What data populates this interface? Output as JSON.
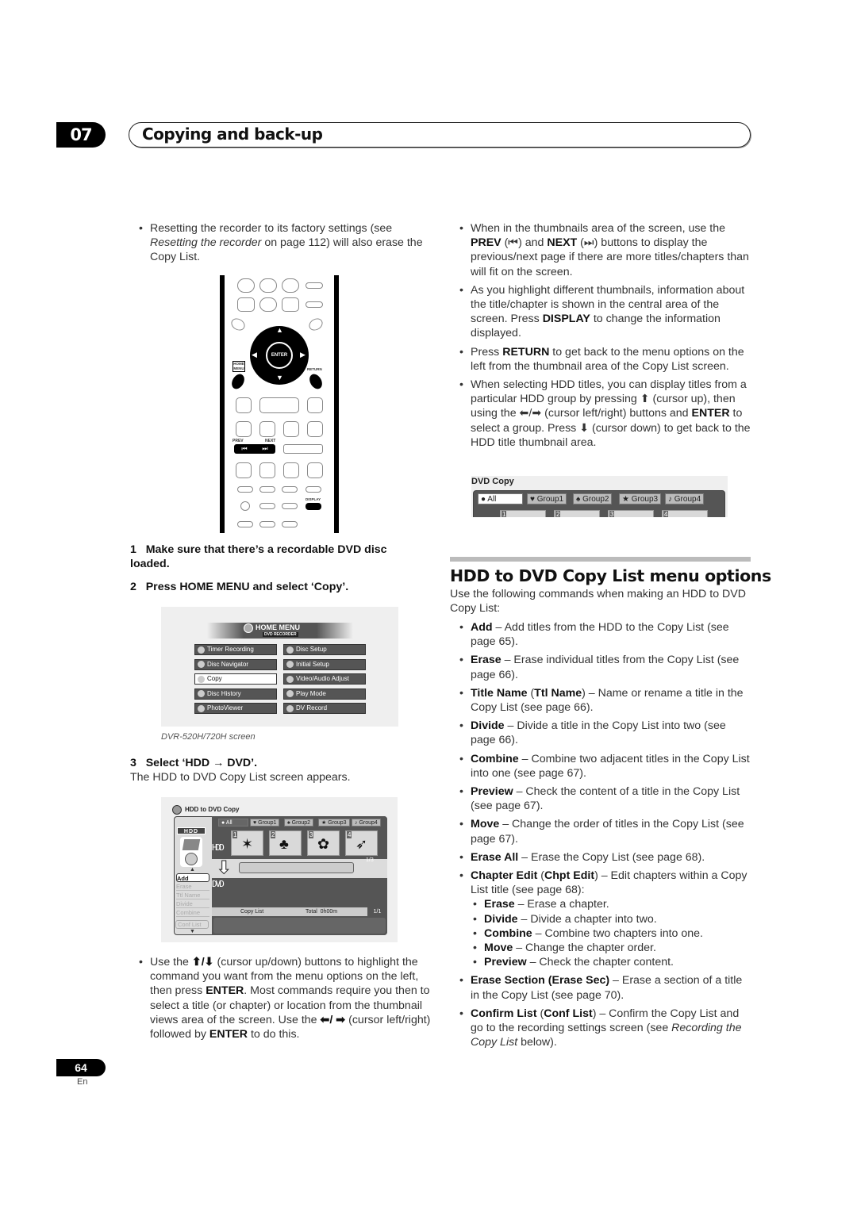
{
  "header": {
    "chapter_number": "07",
    "chapter_title": "Copying and back-up"
  },
  "left_column": {
    "reset_bullet": {
      "pre": "Resetting the recorder to its factory settings (see ",
      "italic": "Resetting the recorder",
      "post": " on page 112) will also erase the Copy List."
    },
    "remote": {
      "labels": {
        "enter": "ENTER",
        "home_menu": "HOME MENU",
        "return": "RETURN",
        "prev": "PREV",
        "next": "NEXT",
        "display": "DISPLAY",
        "prev_glyph": "⏮",
        "next_glyph": "⏭"
      }
    },
    "step1": {
      "num": "1",
      "text": "Make sure that there’s a recordable DVD disc loaded."
    },
    "step2": {
      "num": "2",
      "text": "Press HOME MENU and select ‘Copy’."
    },
    "home_menu_screen": {
      "title": "HOME MENU",
      "subtitle": "DVD RECORDER",
      "left_items": [
        {
          "label": "Timer Recording",
          "selected": false
        },
        {
          "label": "Disc Navigator",
          "selected": false
        },
        {
          "label": "Copy",
          "selected": true
        },
        {
          "label": "Disc History",
          "selected": false
        },
        {
          "label": "PhotoViewer",
          "selected": false
        }
      ],
      "right_items": [
        {
          "label": "Disc Setup"
        },
        {
          "label": "Initial Setup"
        },
        {
          "label": "Video/Audio Adjust"
        },
        {
          "label": "Play Mode"
        },
        {
          "label": "DV Record"
        }
      ],
      "caption": "DVR-520H/720H screen"
    },
    "step3": {
      "num": "3",
      "text": "Select ‘HDD → DVD’.",
      "desc": "The HDD to DVD Copy List screen appears."
    },
    "copy_screen": {
      "title": "HDD to DVD Copy",
      "group_tabs": [
        "All",
        "Group1",
        "Group2",
        "Group3",
        "Group4"
      ],
      "group_icons": [
        "●",
        "♥",
        "♠",
        "★",
        "♪"
      ],
      "hdd_badge": "HDD",
      "hdd_label": "HDD",
      "dvd_label": "DVD",
      "thumbs": [
        "1",
        "2",
        "3",
        "4"
      ],
      "hdd_page": "1/3",
      "commands": [
        {
          "label": "Add",
          "active": true
        },
        {
          "label": "Erase",
          "active": false
        },
        {
          "label": "Ttl Name",
          "active": false
        },
        {
          "label": "Divide",
          "active": false
        },
        {
          "label": "Combine",
          "active": false
        }
      ],
      "conf_list": "Conf List",
      "copy_list_label": "Copy List",
      "total": "Total  0h00m",
      "dvd_page": "1/1"
    },
    "cursor_bullet": {
      "t1": "Use the ",
      "arrows_ud": "⬆/⬇",
      "t2": " (cursor up/down) buttons to highlight the command you want from the menu options on the left, then press ",
      "b1": "ENTER",
      "t3": ". Most commands require you then to select a title (or chapter) or location from the thumbnail views area of the screen. Use the ",
      "arrows_lr": "⬅/ ➡",
      "t4": " (cursor left/right) followed by ",
      "b2": "ENTER",
      "t5": " to do this."
    }
  },
  "right_column": {
    "bullets_top": [
      {
        "html_parts": [
          "When in the thumbnails area of the screen, use the ",
          "**PREV",
          " (⏮) and ",
          "**NEXT",
          " (⏭) buttons to display the previous/next page if there are more titles/chapters than will fit on the screen."
        ]
      },
      {
        "html_parts": [
          "As you highlight different thumbnails, information about the title/chapter is shown in the central area of the screen. Press ",
          "**DISPLAY",
          " to change the information displayed."
        ]
      },
      {
        "html_parts": [
          "Press ",
          "**RETURN",
          " to get back to the menu options on the left from the thumbnail area of the Copy List screen."
        ]
      },
      {
        "html_parts": [
          "When selecting HDD titles, you can display titles from a particular HDD group by pressing ⬆ (cursor up), then using the ⬅/➡ (cursor left/right) buttons and ",
          "**ENTER",
          " to select a group. Press ⬇ (cursor down) to get back to the HDD title thumbnail area."
        ]
      }
    ],
    "dvd_copy_crop": {
      "title": "DVD Copy",
      "tabs": [
        "All",
        "Group1",
        "Group2",
        "Group3",
        "Group4"
      ],
      "icons": [
        "●",
        "♥",
        "♠",
        "★",
        "♪"
      ],
      "thumbs": [
        "1",
        "2",
        "3",
        "4"
      ]
    },
    "section_title": "HDD to DVD Copy List menu options",
    "intro": "Use the following commands when making an HDD to DVD Copy List:",
    "options": [
      {
        "html_parts": [
          "**Add",
          " – Add titles from the HDD to the Copy List (see page 65)."
        ]
      },
      {
        "html_parts": [
          "**Erase",
          " – Erase individual titles from the Copy List (see page 66)."
        ]
      },
      {
        "html_parts": [
          "**Title Name",
          " (",
          "**Ttl Name",
          ") – Name or rename a title in the Copy List (see page 66)."
        ]
      },
      {
        "html_parts": [
          "**Divide",
          " – Divide a title in the Copy List into two (see page 66)."
        ]
      },
      {
        "html_parts": [
          "**Combine",
          " – Combine two adjacent titles in the Copy List into one (see page 67)."
        ]
      },
      {
        "html_parts": [
          "**Preview",
          " – Check the content of a title in the Copy List (see page 67)."
        ]
      },
      {
        "html_parts": [
          "**Move",
          " – Change the order of titles in the Copy List (see page 67)."
        ]
      },
      {
        "html_parts": [
          "**Erase All",
          " – Erase the Copy List (see page 68)."
        ]
      },
      {
        "html_parts": [
          "**Chapter Edit",
          " (",
          "**Chpt Edit",
          ") – Edit chapters within a Copy List title (see page 68):"
        ]
      }
    ],
    "chapter_sub": [
      {
        "html_parts": [
          "**Erase",
          " – Erase a chapter."
        ]
      },
      {
        "html_parts": [
          "**Divide",
          " – Divide a chapter into two."
        ]
      },
      {
        "html_parts": [
          "**Combine",
          " – Combine two chapters into one."
        ]
      },
      {
        "html_parts": [
          "**Move",
          " – Change the chapter order."
        ]
      },
      {
        "html_parts": [
          "**Preview",
          " – Check the chapter content."
        ]
      }
    ],
    "options_after": [
      {
        "html_parts": [
          "**Erase Section (Erase Sec)",
          " – Erase a section of a title in the Copy List (see page 70)."
        ]
      },
      {
        "html_parts": [
          "**Confirm List",
          " (",
          "**Conf List",
          ") – Confirm the Copy List and go to the recording settings screen (see ",
          "//Recording the Copy List",
          " below)."
        ]
      }
    ]
  },
  "footer": {
    "page_number": "64",
    "language": "En"
  }
}
